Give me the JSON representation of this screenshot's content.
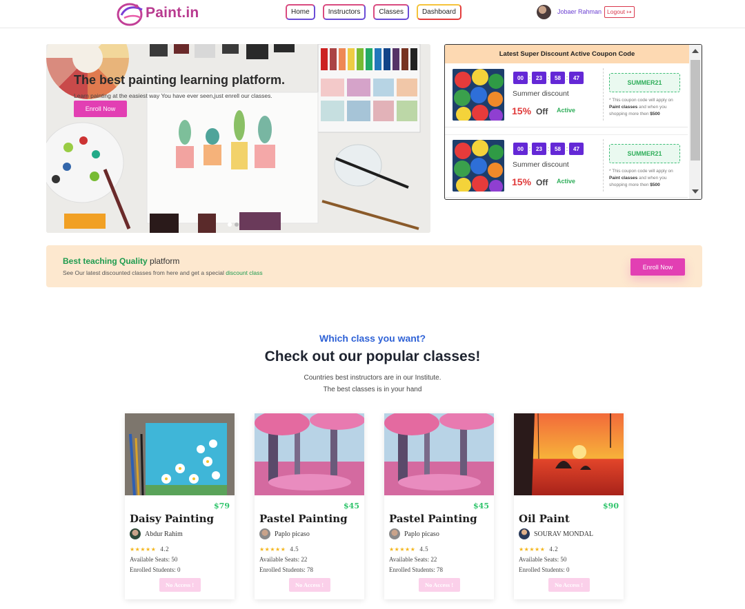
{
  "nav": {
    "brand": "Paint.in",
    "links": [
      "Home",
      "Instructors",
      "Classes",
      "Dashboard"
    ],
    "user_name": "Jobaer Rahman",
    "logout_label": "Logout"
  },
  "hero": {
    "title": "The best painting learning platform.",
    "subtitle": "Learn painting at the easiest way You have ever seen,just enrell our classes.",
    "button": "Enroll Now"
  },
  "coupons": {
    "header": "Latest Super Discount Active Coupon Code",
    "items": [
      {
        "countdown": [
          "00",
          "23",
          "58",
          "47"
        ],
        "title": "Summer discount",
        "percent": "15%",
        "off": "Off",
        "status": "Active",
        "code": "SUMMER21",
        "note_pre": "* This coupon code will apply on",
        "note_bold": "Paint classes",
        "note_mid": "and when you shopping more then",
        "note_amt": "$500"
      },
      {
        "countdown": [
          "00",
          "23",
          "58",
          "47"
        ],
        "title": "Summer discount",
        "percent": "15%",
        "off": "Off",
        "status": "Active",
        "code": "SUMMER21",
        "note_pre": "* This coupon code will apply on",
        "note_bold": "Paint classes",
        "note_mid": "and when you shopping more then",
        "note_amt": "$500"
      }
    ]
  },
  "banner": {
    "title_green": "Best teaching Quality",
    "title_rest": "platform",
    "sub_pre": "See Our latest discounted classes from here and get a special",
    "sub_link": "discount class",
    "button": "Enroll Now"
  },
  "section": {
    "kicker": "Which class you want?",
    "title": "Check out our popular classes!",
    "line1": "Countries best instructors are in our Institute.",
    "line2": "The best classes is in your hand"
  },
  "classes": [
    {
      "price": "$79",
      "title": "Daisy Painting",
      "instructor": "Abdur Rahim",
      "stars": "★★★★★",
      "rating": "4.2",
      "seats": "Available Seats: 50",
      "enrolled": "Enrolled Students: 0",
      "action": "No Access !"
    },
    {
      "price": "$45",
      "title": "Pastel Painting",
      "instructor": "Paplo picaso",
      "stars": "★★★★★",
      "rating": "4.5",
      "seats": "Available Seats: 22",
      "enrolled": "Enrolled Students: 78",
      "action": "No Access !"
    },
    {
      "price": "$45",
      "title": "Pastel Painting",
      "instructor": "Paplo picaso",
      "stars": "★★★★★",
      "rating": "4.5",
      "seats": "Available Seats: 22",
      "enrolled": "Enrolled Students: 78",
      "action": "No Access !"
    },
    {
      "price": "$90",
      "title": "Oil Paint",
      "instructor": "SOURAV MONDAL",
      "stars": "★★★★★",
      "rating": "4.2",
      "seats": "Available Seats: 50",
      "enrolled": "Enrolled Students: 0",
      "action": "No Access !"
    }
  ]
}
